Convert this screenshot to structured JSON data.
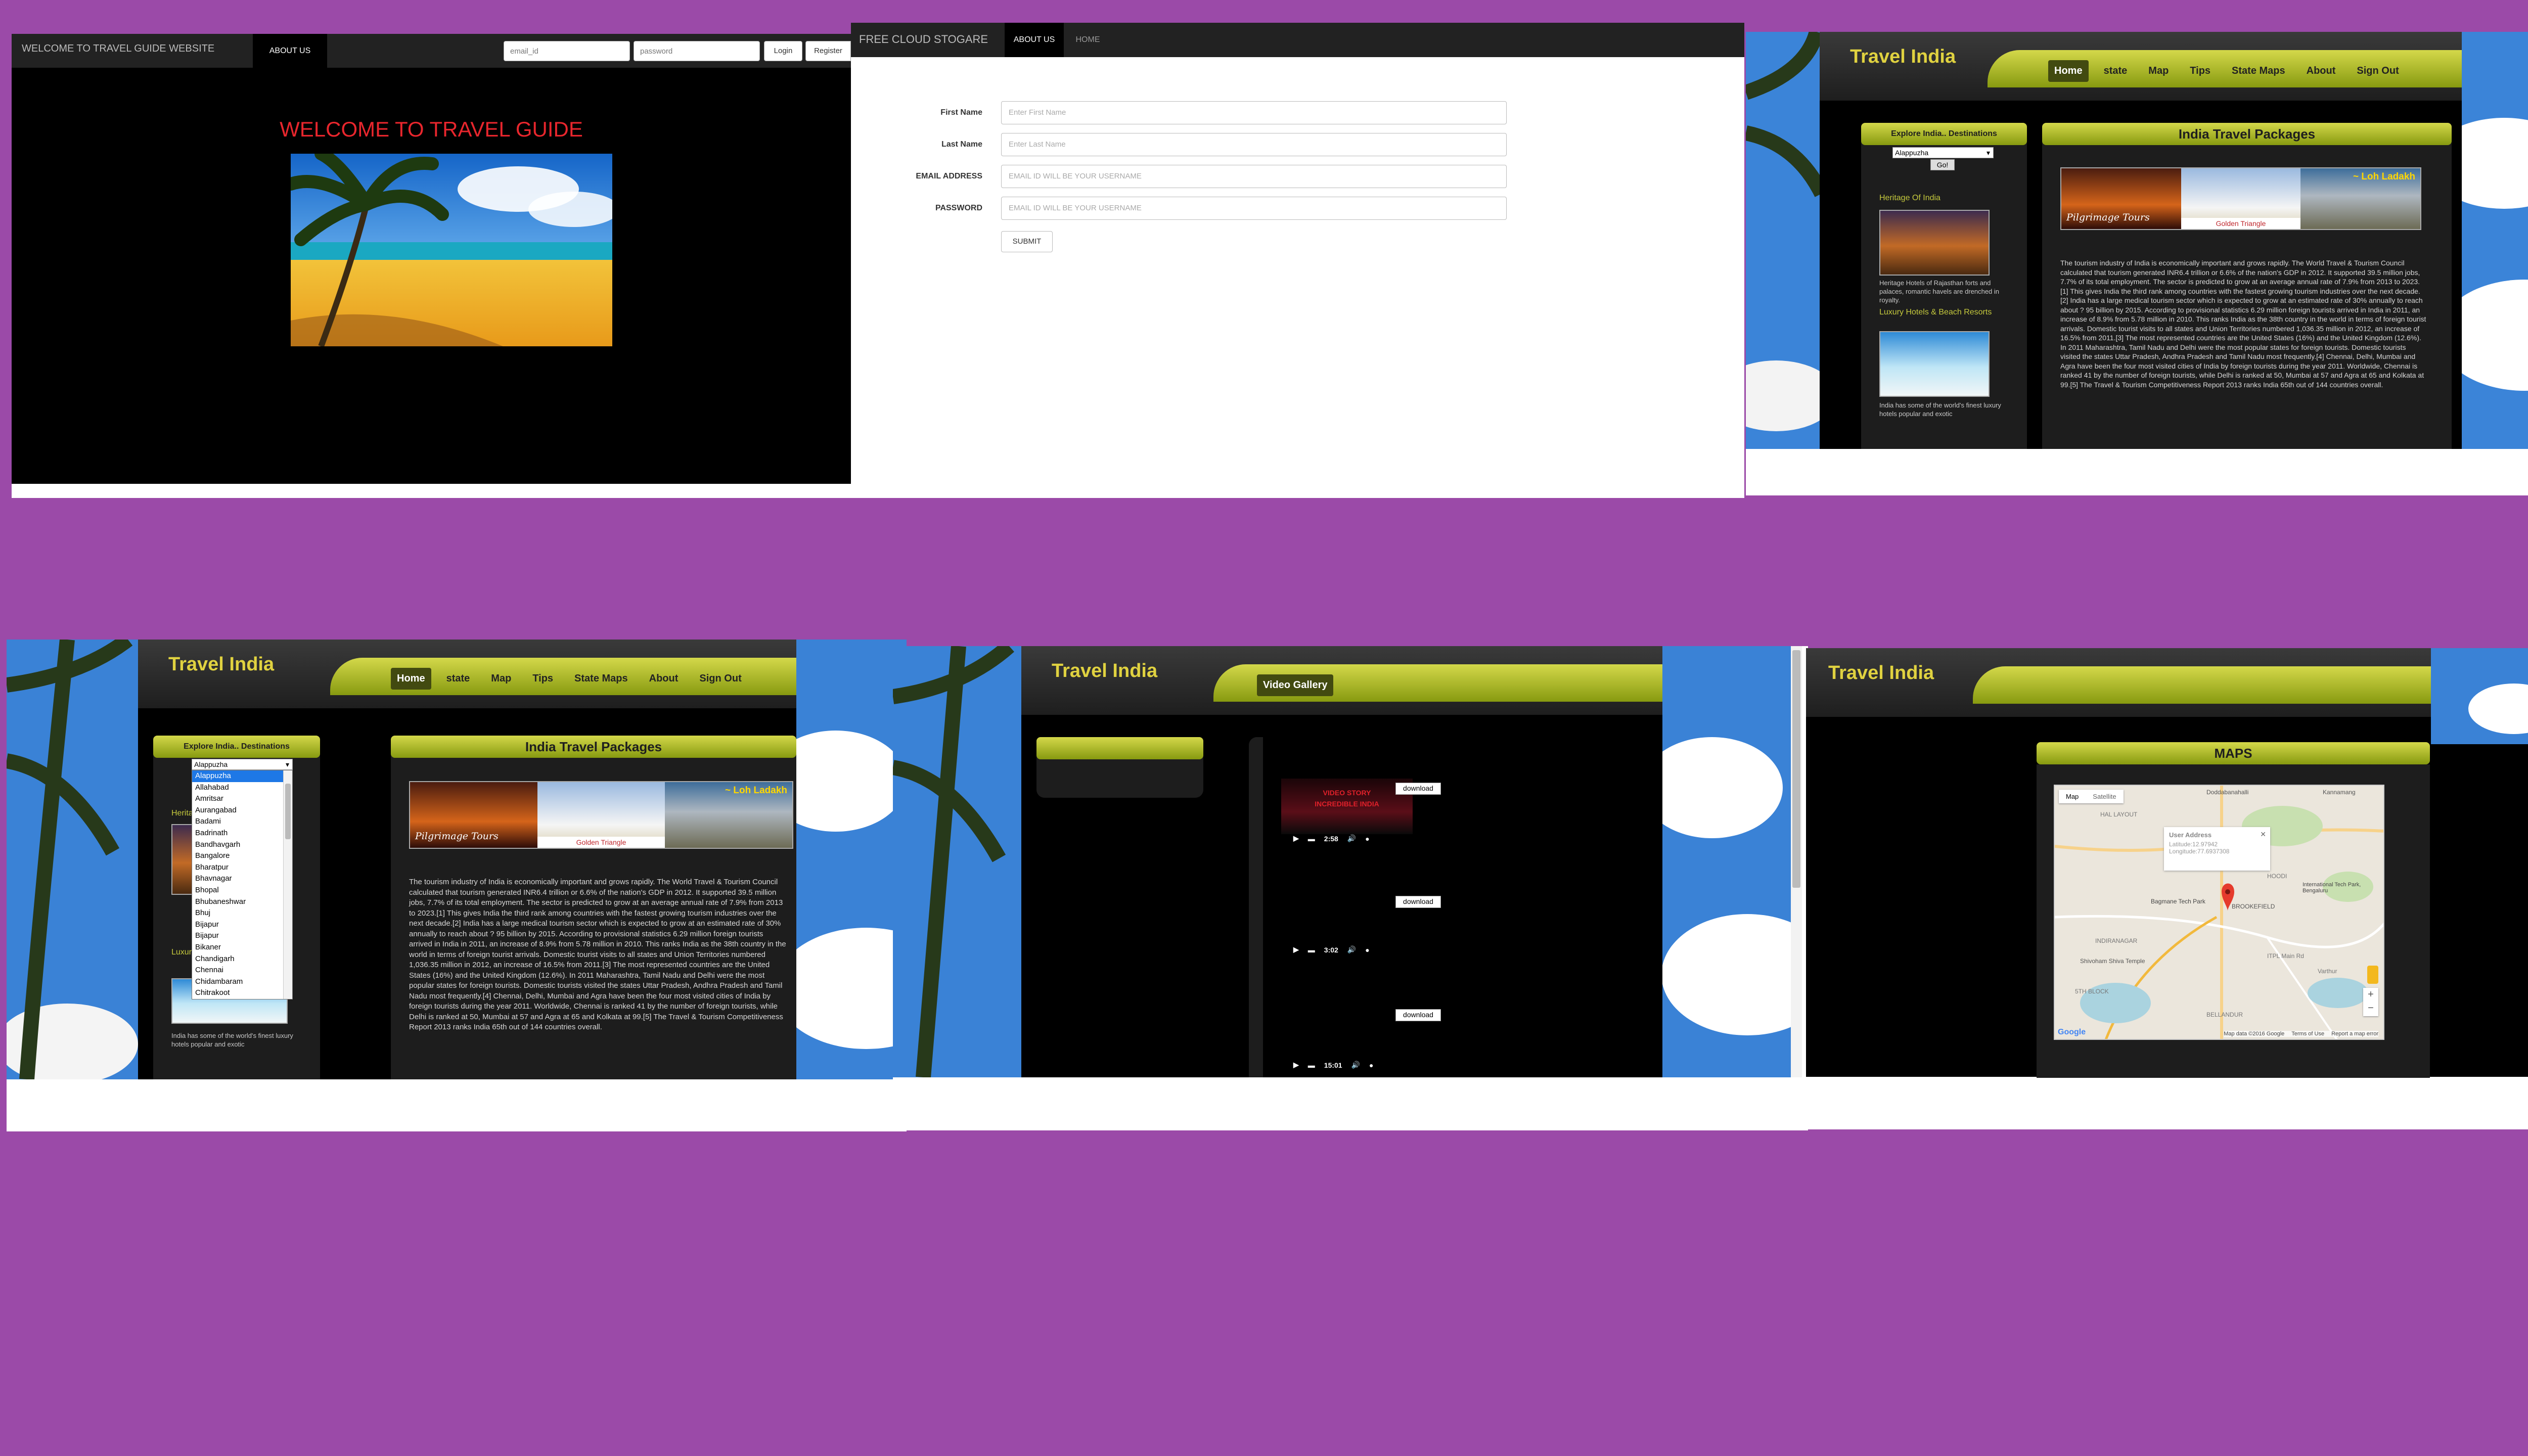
{
  "panel1": {
    "brand": "WELCOME TO TRAVEL GUIDE WEBSITE",
    "about": "ABOUT US",
    "email_placeholder": "email_id",
    "password_placeholder": "password",
    "login": "Login",
    "register": "Register",
    "heading": "WELCOME TO TRAVEL GUIDE"
  },
  "panel2": {
    "brand": "FREE CLOUD STOGARE",
    "about": "ABOUT US",
    "home": "HOME",
    "fields": [
      {
        "label": "First Name",
        "placeholder": "Enter First Name"
      },
      {
        "label": "Last Name",
        "placeholder": "Enter Last Name"
      },
      {
        "label": "EMAIL ADDRESS",
        "placeholder": "EMAIL ID WILL BE YOUR USERNAME"
      },
      {
        "label": "PASSWORD",
        "placeholder": "EMAIL ID WILL BE YOUR USERNAME"
      }
    ],
    "submit": "SUBMIT"
  },
  "site": {
    "title": "Travel India",
    "nav": [
      "Home",
      "state",
      "Map",
      "Tips",
      "State Maps",
      "About",
      "Sign Out"
    ],
    "sidebar_title": "Explore India.. Destinations",
    "dropdown_value": "Alappuzha",
    "go": "Go!",
    "heritage_title": "Heritage Of India",
    "heritage_text": "Heritage Hotels of Rajasthan forts and palaces, romantic havels are drenched in royalty.",
    "luxury_title": "Luxury Hotels & Beach Resorts",
    "luxury_text": "India has some of the world's finest luxury hotels popular and exotic",
    "packages_title": "India Travel Packages",
    "banner_pilgrimage": "Pilgrimage Tours",
    "banner_golden": "Golden Triangle",
    "banner_loh": "~ Loh Ladakh",
    "paragraph": "The tourism industry of India is economically important and grows rapidly. The World Travel & Tourism Council calculated that tourism generated INR6.4 trillion or 6.6% of the nation's GDP in 2012. It supported 39.5 million jobs, 7.7% of its total employment. The sector is predicted to grow at an average annual rate of 7.9% from 2013 to 2023.[1] This gives India the third rank among countries with the fastest growing tourism industries over the next decade.[2] India has a large medical tourism sector which is expected to grow at an estimated rate of 30% annually to reach about ? 95 billion by 2015. According to provisional statistics 6.29 million foreign tourists arrived in India in 2011, an increase of 8.9% from 5.78 million in 2010. This ranks India as the 38th country in the world in terms of foreign tourist arrivals. Domestic tourist visits to all states and Union Territories numbered 1,036.35 million in 2012, an increase of 16.5% from 2011.[3] The most represented countries are the United States (16%) and the United Kingdom (12.6%). In 2011 Maharashtra, Tamil Nadu and Delhi were the most popular states for foreign tourists. Domestic tourists visited the states Uttar Pradesh, Andhra Pradesh and Tamil Nadu most frequently.[4] Chennai, Delhi, Mumbai and Agra have been the four most visited cities of India by foreign tourists during the year 2011. Worldwide, Chennai is ranked 41 by the number of foreign tourists, while Delhi is ranked at 50, Mumbai at 57 and Agra at 65 and Kolkata at 99.[5] The Travel & Tourism Competitiveness Report 2013 ranks India 65th out of 144 countries overall."
  },
  "dropdown_options": [
    "Alappuzha",
    "Allahabad",
    "Amritsar",
    "Aurangabad",
    "Badami",
    "Badrinath",
    "Bandhavgarh",
    "Bangalore",
    "Bharatpur",
    "Bhavnagar",
    "Bhopal",
    "Bhubaneshwar",
    "Bhuj",
    "Bijapur",
    "Bijapur",
    "Bikaner",
    "Chandigarh",
    "Chennai",
    "Chidambaram",
    "Chitrakoot"
  ],
  "video": {
    "menu_item": "Video Gallery",
    "download": "download",
    "durations": [
      "2:58",
      "3:02",
      "15:01"
    ],
    "poster_line1": "VIDEO STORY",
    "poster_line2": "INCREDIBLE INDIA"
  },
  "maps": {
    "title": "MAPS",
    "map_tab": "Map",
    "satellite_tab": "Satellite",
    "info_title": "User Address",
    "info_lat": "Latitude:12.97942",
    "info_lng": "Longitude:77.6937308",
    "places": [
      "Doddabanahalli",
      "Kannamang",
      "HAL LAYOUT",
      "International Tech Park, Bengaluru",
      "Bagmane Tech Park",
      "BROOKEFIELD",
      "INDIRANAGAR",
      "HOODI",
      "Shivoham Shiva Temple",
      "5TH BLOCK",
      "BELLANDUR",
      "ITPL Main Rd",
      "Varthur"
    ],
    "footer": "Map data ©2016 Google",
    "terms": "Terms of Use",
    "report": "Report a map error",
    "google": "Google"
  }
}
